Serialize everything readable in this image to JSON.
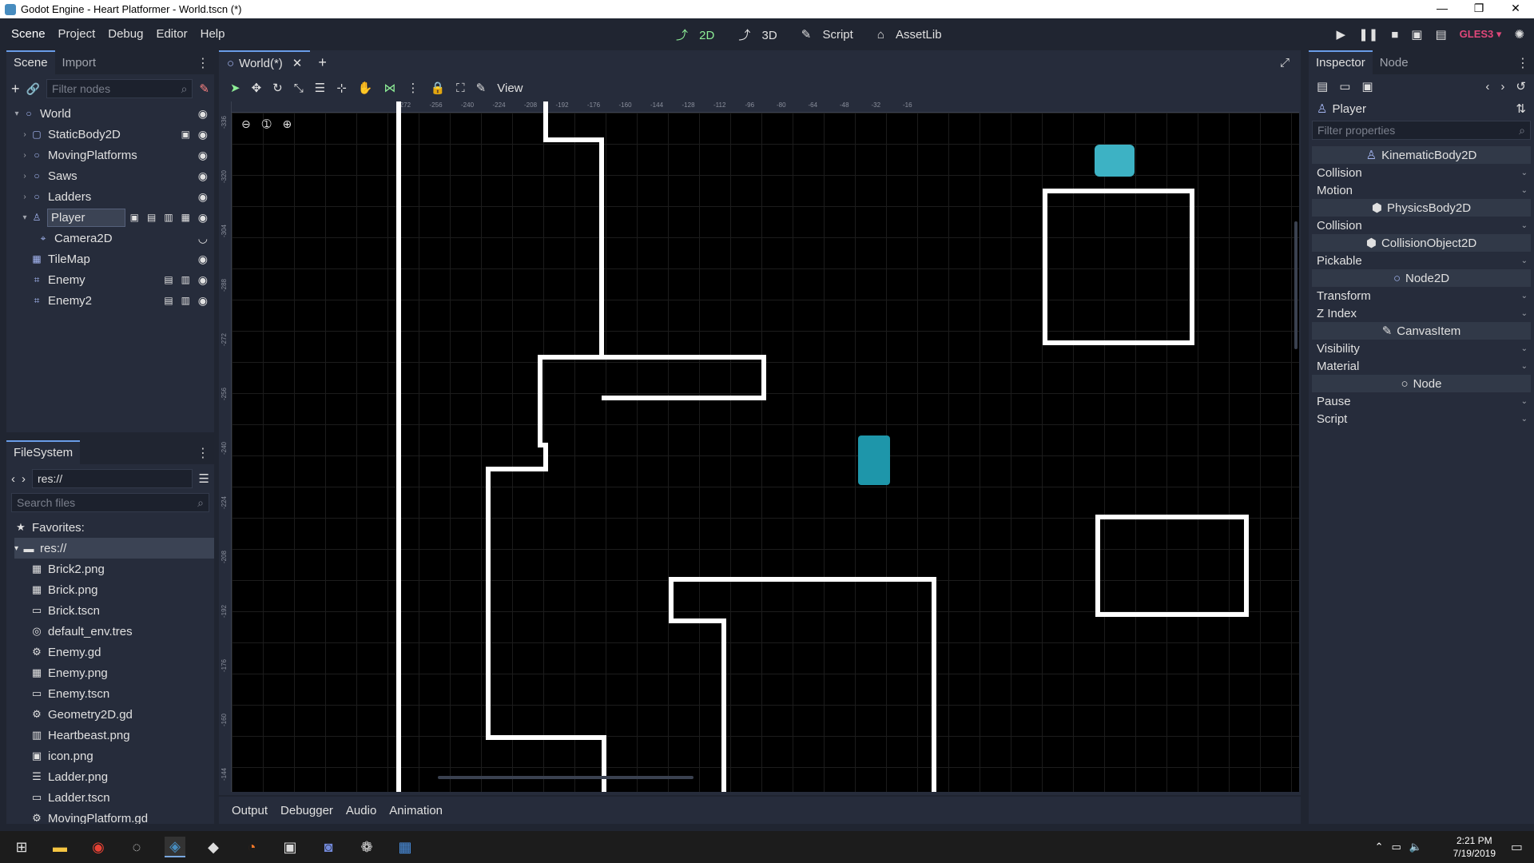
{
  "window": {
    "title": "Godot Engine - Heart Platformer - World.tscn (*)",
    "controls": [
      "—",
      "❐",
      "✕"
    ]
  },
  "menubar": {
    "menus": [
      "Scene",
      "Project",
      "Debug",
      "Editor",
      "Help"
    ],
    "workspaces": [
      "2D",
      "3D",
      "Script",
      "AssetLib"
    ],
    "renderer": "GLES3"
  },
  "scene_dock": {
    "tabs": [
      "Scene",
      "Import"
    ],
    "filter_placeholder": "Filter nodes",
    "nodes": [
      {
        "name": "World",
        "icon": "node2d-icon"
      },
      {
        "name": "StaticBody2D",
        "icon": "staticbody-icon"
      },
      {
        "name": "MovingPlatforms",
        "icon": "node2d-icon"
      },
      {
        "name": "Saws",
        "icon": "node2d-icon"
      },
      {
        "name": "Ladders",
        "icon": "node2d-icon"
      },
      {
        "name": "Player",
        "icon": "kinematicbody-icon"
      },
      {
        "name": "Camera2D",
        "icon": "camera-icon"
      },
      {
        "name": "TileMap",
        "icon": "tilemap-icon"
      },
      {
        "name": "Enemy",
        "icon": "kinematicbody-icon"
      },
      {
        "name": "Enemy2",
        "icon": "kinematicbody-icon"
      }
    ]
  },
  "filesystem": {
    "tab": "FileSystem",
    "path": "res://",
    "search_placeholder": "Search files",
    "favorites_label": "Favorites:",
    "root_label": "res://",
    "files": [
      "Brick2.png",
      "Brick.png",
      "Brick.tscn",
      "default_env.tres",
      "Enemy.gd",
      "Enemy.png",
      "Enemy.tscn",
      "Geometry2D.gd",
      "Heartbeast.png",
      "icon.png",
      "Ladder.png",
      "Ladder.tscn",
      "MovingPlatform.gd"
    ]
  },
  "viewport": {
    "tab_label": "World(*)",
    "view_menu": "View",
    "ruler_x": [
      "-272",
      "-256",
      "-240",
      "-224",
      "-208",
      "-192",
      "-176",
      "-160",
      "-144",
      "-128",
      "-112",
      "-96",
      "-80",
      "-64",
      "-48",
      "-32",
      "-16"
    ],
    "ruler_y": [
      "-336",
      "-320",
      "-304",
      "-288",
      "-272",
      "-256",
      "-240",
      "-224",
      "-208",
      "-192",
      "-176",
      "-160",
      "-144"
    ]
  },
  "bottom_panel": {
    "tabs": [
      "Output",
      "Debugger",
      "Audio",
      "Animation"
    ]
  },
  "inspector": {
    "tabs": [
      "Inspector",
      "Node"
    ],
    "node_name": "Player",
    "filter_placeholder": "Filter properties",
    "sections": [
      {
        "category": "KinematicBody2D",
        "props": [
          "Collision",
          "Motion"
        ]
      },
      {
        "category": "PhysicsBody2D",
        "props": [
          "Collision"
        ]
      },
      {
        "category": "CollisionObject2D",
        "props": [
          "Pickable"
        ]
      },
      {
        "category": "Node2D",
        "props": [
          "Transform",
          "Z Index"
        ]
      },
      {
        "category": "CanvasItem",
        "props": [
          "Visibility",
          "Material"
        ]
      },
      {
        "category": "Node",
        "props": [
          "Pause",
          "Script"
        ]
      }
    ]
  },
  "taskbar": {
    "time": "2:21 PM",
    "date": "7/19/2019"
  }
}
